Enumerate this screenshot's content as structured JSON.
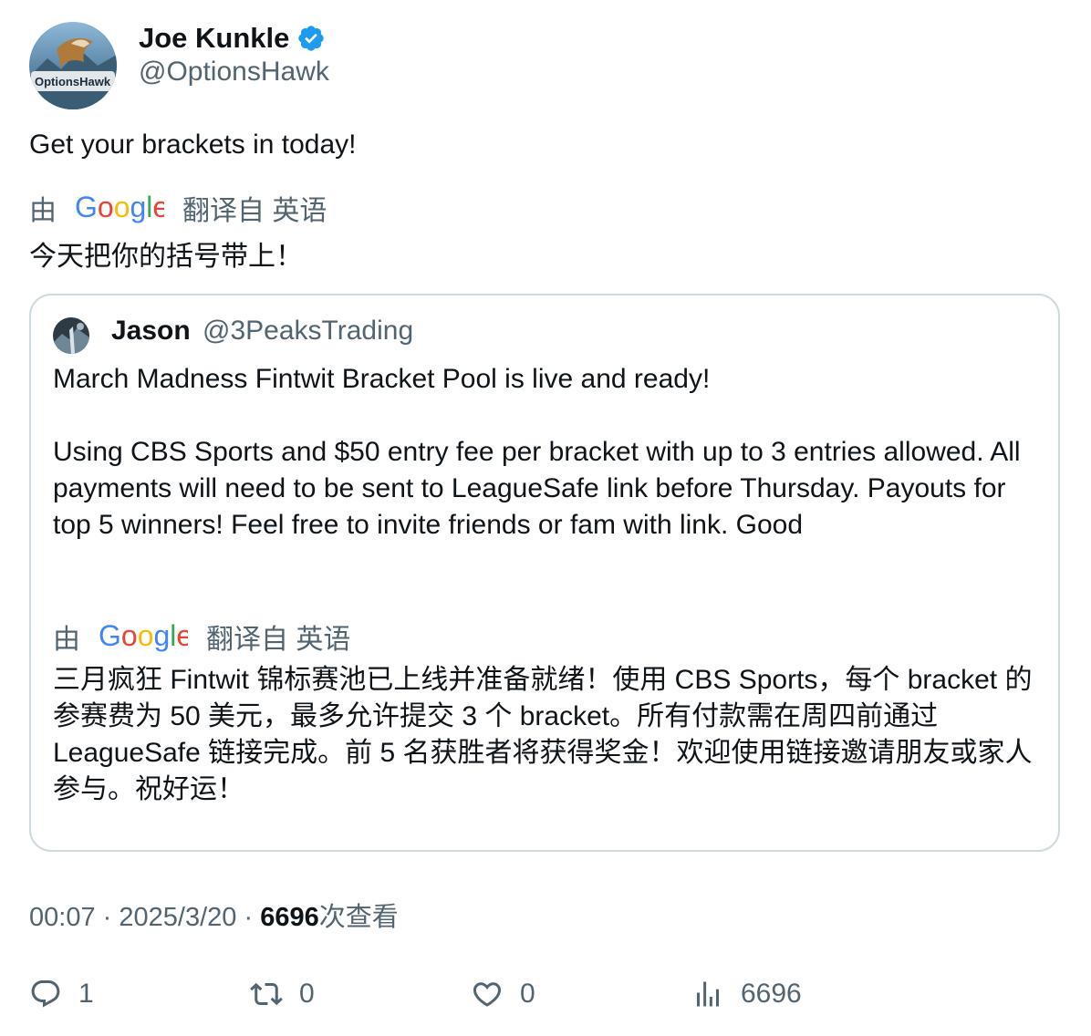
{
  "author": {
    "name": "Joe Kunkle",
    "handle": "@OptionsHawk",
    "avatar_label": "OptionsHawk"
  },
  "tweet": {
    "text": "Get your brackets in today!",
    "translation": {
      "prefix": "由",
      "suffix": "翻译自 英语",
      "text": "今天把你的括号带上！"
    }
  },
  "quote": {
    "name": "Jason",
    "handle": "@3PeaksTrading",
    "line1": "March Madness Fintwit Bracket Pool is live and ready!",
    "line2": "Using CBS Sports and $50 entry fee per bracket with up to 3 entries allowed. All payments will need to be sent to LeagueSafe link before Thursday. Payouts for top 5 winners! Feel free to invite friends or fam with link. Good",
    "translation": {
      "prefix": "由",
      "suffix": "翻译自 英语",
      "text": "三月疯狂 Fintwit 锦标赛池已上线并准备就绪！使用 CBS Sports，每个 bracket 的参赛费为 50 美元，最多允许提交 3 个 bracket。所有付款需在周四前通过 LeagueSafe 链接完成。前 5 名获胜者将获得奖金！欢迎使用链接邀请朋友或家人参与。祝好运！"
    }
  },
  "meta": {
    "time": "00:07",
    "separator": "·",
    "date": "2025/3/20",
    "views_count": "6696",
    "views_label": "次查看"
  },
  "actions": {
    "reply_count": "1",
    "retweet_count": "0",
    "like_count": "0",
    "views_count": "6696"
  },
  "colors": {
    "text_primary": "#0f1419",
    "text_secondary": "#536471",
    "border": "#cfd9de",
    "verified": "#1d9bf0"
  },
  "icons": [
    "verified-badge-icon",
    "google-logo",
    "reply-icon",
    "retweet-icon",
    "like-icon",
    "views-icon"
  ]
}
